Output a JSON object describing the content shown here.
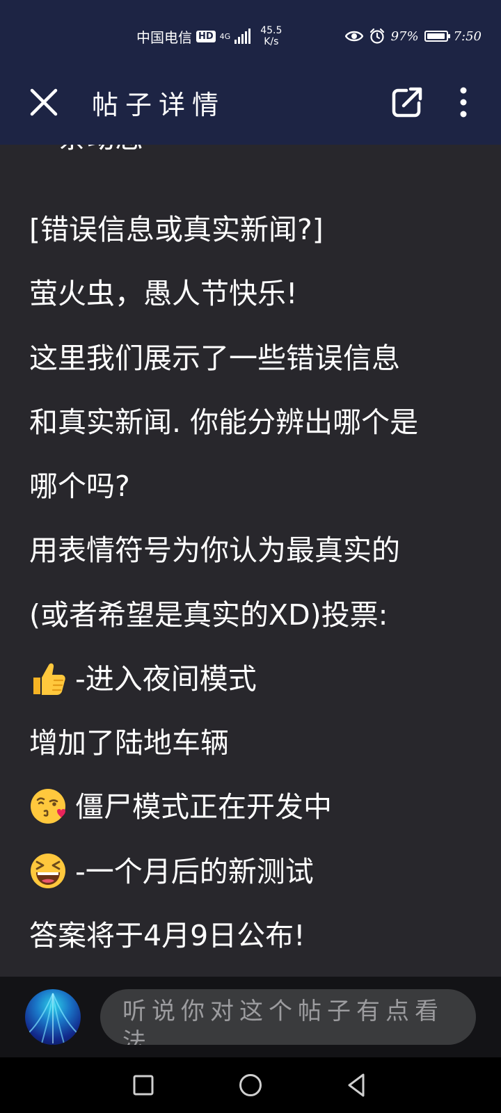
{
  "status_bar": {
    "carrier": "中国电信",
    "hd_badge": "HD",
    "network_type": "4G",
    "net_speed_value": "45.5",
    "net_speed_unit": "K/s",
    "battery_percent": "97%",
    "battery_level": 0.97,
    "time": "7:50",
    "icons": [
      "hd-icon",
      "signal-icon",
      "eye-icon",
      "alarm-icon",
      "battery-icon"
    ]
  },
  "app_bar": {
    "title": "帖子详情",
    "icons": [
      "close-icon",
      "share-icon",
      "more-vertical-icon"
    ]
  },
  "post": {
    "partial_top_line": "一条动态",
    "lines": [
      "[错误信息或真实新闻?]",
      "萤火虫，愚人节快乐!",
      "这里我们展示了一些错误信息",
      "和真实新闻. 你能分辨出哪个是",
      "哪个吗?",
      "用表情符号为你认为最真实的",
      "(或者希望是真实的XD)投票:",
      "-进入夜间模式",
      "增加了陆地车辆",
      "僵尸模式正在开发中",
      "-一个月后的新测试",
      "答案将于4月9日公布!"
    ],
    "emojis": [
      "thumbs-up-emoji",
      "kissing-heart-emoji",
      "grinning-squinting-emoji"
    ]
  },
  "comment_bar": {
    "placeholder": "听说你对这个帖子有点看法"
  },
  "nav_bar": {
    "icons": [
      "recent-apps-icon",
      "home-icon",
      "back-icon"
    ]
  },
  "colors": {
    "header_bg": "#1d2444",
    "content_bg": "#28272c",
    "comment_bar_bg": "#131316",
    "input_bg": "#3a3b3d",
    "text": "#ffffff",
    "placeholder": "#9c9c9f"
  }
}
